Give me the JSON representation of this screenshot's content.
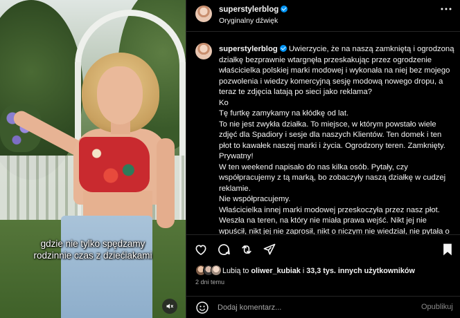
{
  "video": {
    "caption_line1": "gdzie nie tylko spędzamy",
    "caption_line2": "rodzinnie czas z dziećiakami",
    "mute_icon": "speaker-muted-icon"
  },
  "header": {
    "username": "superstylerblog",
    "audio": "Oryginalny dźwięk",
    "more_icon": "more-horizontal-icon"
  },
  "caption": {
    "username": "superstylerblog",
    "paragraphs": [
      "Uwierzycie, że na naszą zamkniętą i ogrodzoną działkę bezprawnie wtargnęła przeskakując przez ogrodzenie właścicielka polskiej marki modowej i wykonała na niej bez mojego pozwolenia i wiedzy komercyjną sesję modową nowego dropu, a teraz te zdjęcia latają po sieci jako reklama?",
      "Ko",
      "Tę furtkę zamykamy na kłódkę od lat.",
      "To nie jest zwykła działka. To miejsce, w którym powstało wiele zdjęć dla Spadiory i sesje dla naszych Klientów. Ten domek i ten płot to kawałek naszej marki i życia. Ogrodzony teren. Zamknięty. Prywatny!",
      "W ten weekend napisało do nas kilka osób. Pytały, czy współpracujemy z tą marką, bo zobaczyły naszą działkę w cudzej reklamie.",
      "Nie współpracujemy.",
      "Właścicielka innej marki modowej przeskoczyła przez nasz płot. Weszła na teren, na który nie miała prawa wejść. Nikt jej nie wpuścił, nikt jej nie zaprosił, nikt o niczym nie wiedział, nie pytała o zgodę. Nie tylko weszła na nasz teren, ale również położyła się"
    ]
  },
  "actions": {
    "like_icon": "heart-icon",
    "comment_icon": "comment-icon",
    "share_icon": "share-icon",
    "send_icon": "send-icon",
    "save_icon": "bookmark-icon"
  },
  "likes": {
    "prefix": "Lubią to",
    "user": "oliwer_kubiak",
    "middle": "i",
    "count": "33,3 tys. innych użytkowników"
  },
  "date": "2 dni temu",
  "composer": {
    "emoji_icon": "emoji-icon",
    "placeholder": "Dodaj komentarz...",
    "post_label": "Opublikuj"
  },
  "colors": {
    "background": "#000000",
    "text": "#f5f5f5",
    "muted": "#a8a8a8",
    "verified": "#0095f6",
    "divider": "#262626"
  }
}
